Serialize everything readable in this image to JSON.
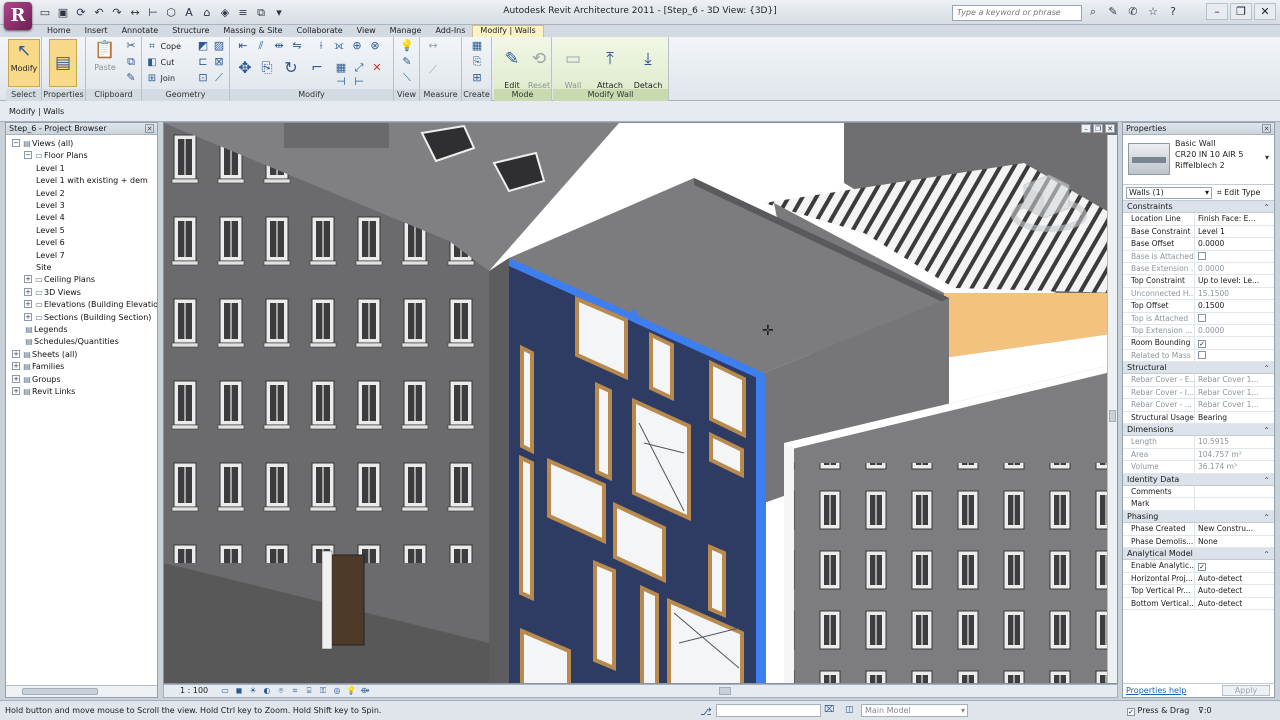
{
  "app": {
    "title": "Autodesk Revit Architecture 2011 - [Step_6 - 3D View: {3D}]",
    "logo_letter": "R",
    "search_placeholder": "Type a keyword or phrase"
  },
  "tabs": [
    "Home",
    "Insert",
    "Annotate",
    "Structure",
    "Massing & Site",
    "Collaborate",
    "View",
    "Manage",
    "Add-Ins",
    "Modify | Walls"
  ],
  "active_tab": "Modify | Walls",
  "ribbon": {
    "select": {
      "modify": "Modify",
      "label": "Select"
    },
    "properties": {
      "label": "Properties"
    },
    "clipboard": {
      "paste": "Paste",
      "label": "Clipboard"
    },
    "geometry": {
      "cope": "Cope",
      "cut": "Cut",
      "join": "Join",
      "label": "Geometry"
    },
    "modify": {
      "label": "Modify"
    },
    "view": {
      "label": "View"
    },
    "measure": {
      "label": "Measure"
    },
    "create": {
      "label": "Create"
    },
    "mode": {
      "edit_profile": "Edit\nProfile",
      "reset_profile": "Reset\nProfile",
      "label": "Mode"
    },
    "modify_wall": {
      "wall_opening": "Wall\nOpening",
      "attach": "Attach\nTop/Base",
      "detach": "Detach\nTop/Base",
      "label": "Modify Wall"
    }
  },
  "options_bar": "Modify | Walls",
  "project_browser": {
    "title": "Step_6 - Project Browser",
    "items": [
      {
        "label": "Views (all)",
        "level": 0,
        "exp": "−"
      },
      {
        "label": "Floor Plans",
        "level": 1,
        "exp": "−"
      },
      {
        "label": "Level 1",
        "level": 2
      },
      {
        "label": "Level 1 with existing + dem",
        "level": 2
      },
      {
        "label": "Level 2",
        "level": 2
      },
      {
        "label": "Level 3",
        "level": 2
      },
      {
        "label": "Level 4",
        "level": 2
      },
      {
        "label": "Level 5",
        "level": 2
      },
      {
        "label": "Level 6",
        "level": 2
      },
      {
        "label": "Level 7",
        "level": 2
      },
      {
        "label": "Site",
        "level": 2
      },
      {
        "label": "Ceiling Plans",
        "level": 1,
        "exp": "+"
      },
      {
        "label": "3D Views",
        "level": 1,
        "exp": "+"
      },
      {
        "label": "Elevations (Building Elevation)",
        "level": 1,
        "exp": "+"
      },
      {
        "label": "Sections (Building Section)",
        "level": 1,
        "exp": "+"
      },
      {
        "label": "Legends",
        "level": 0,
        "icon": true
      },
      {
        "label": "Schedules/Quantities",
        "level": 0,
        "icon": true
      },
      {
        "label": "Sheets (all)",
        "level": 0,
        "exp": "+"
      },
      {
        "label": "Families",
        "level": 0,
        "exp": "+"
      },
      {
        "label": "Groups",
        "level": 0,
        "exp": "+"
      },
      {
        "label": "Revit Links",
        "level": 0,
        "exp": "+"
      }
    ]
  },
  "view_bar": {
    "scale": "1 : 100"
  },
  "properties": {
    "title": "Properties",
    "type_name": [
      "Basic Wall",
      "CR20 IN 10 AIR 5",
      "Riffelblech 2"
    ],
    "filter": "Walls (1)",
    "edit_type": "Edit Type",
    "sections": [
      {
        "name": "Constraints",
        "rows": [
          {
            "k": "Location Line",
            "v": "Finish Face: E..."
          },
          {
            "k": "Base Constraint",
            "v": "Level 1"
          },
          {
            "k": "Base Offset",
            "v": "0.0000"
          },
          {
            "k": "Base is Attached",
            "v": "",
            "chk": false,
            "ro": true
          },
          {
            "k": "Base Extension ...",
            "v": "0.0000",
            "ro": true
          },
          {
            "k": "Top Constraint",
            "v": "Up to level: Le..."
          },
          {
            "k": "Unconnected H...",
            "v": "15.1500",
            "ro": true
          },
          {
            "k": "Top Offset",
            "v": "0.1500"
          },
          {
            "k": "Top is Attached",
            "v": "",
            "chk": false,
            "ro": true
          },
          {
            "k": "Top Extension ...",
            "v": "0.0000",
            "ro": true
          },
          {
            "k": "Room Bounding",
            "v": "",
            "chk": true
          },
          {
            "k": "Related to Mass",
            "v": "",
            "chk": false,
            "ro": true
          }
        ]
      },
      {
        "name": "Structural",
        "rows": [
          {
            "k": "Rebar Cover - E...",
            "v": "Rebar Cover 1...",
            "ro": true
          },
          {
            "k": "Rebar Cover - I...",
            "v": "Rebar Cover 1...",
            "ro": true
          },
          {
            "k": "Rebar Cover - ...",
            "v": "Rebar Cover 1...",
            "ro": true
          },
          {
            "k": "Structural Usage",
            "v": "Bearing"
          }
        ]
      },
      {
        "name": "Dimensions",
        "rows": [
          {
            "k": "Length",
            "v": "10.5915",
            "ro": true
          },
          {
            "k": "Area",
            "v": "104.757 m²",
            "ro": true
          },
          {
            "k": "Volume",
            "v": "36.174 m³",
            "ro": true
          }
        ]
      },
      {
        "name": "Identity Data",
        "rows": [
          {
            "k": "Comments",
            "v": ""
          },
          {
            "k": "Mark",
            "v": ""
          }
        ]
      },
      {
        "name": "Phasing",
        "rows": [
          {
            "k": "Phase Created",
            "v": "New Constru..."
          },
          {
            "k": "Phase Demolis...",
            "v": "None"
          }
        ]
      },
      {
        "name": "Analytical Model",
        "rows": [
          {
            "k": "Enable Analytic...",
            "v": "",
            "chk": true
          },
          {
            "k": "Horizontal Proj...",
            "v": "Auto-detect"
          },
          {
            "k": "Top Vertical Pr...",
            "v": "Auto-detect"
          },
          {
            "k": "Bottom Vertical...",
            "v": "Auto-detect"
          }
        ]
      }
    ],
    "help": "Properties help",
    "apply": "Apply"
  },
  "status": {
    "text": "Hold button and move mouse to Scroll the view. Hold Ctrl key to Zoom. Hold Shift key to Spin.",
    "main_model": "Main Model",
    "press_drag": "Press & Drag",
    "filter": ":0"
  },
  "colors": {
    "accent_wall": "#2e3b63",
    "selection": "#3d7ff0",
    "building": "#6e6e70"
  }
}
